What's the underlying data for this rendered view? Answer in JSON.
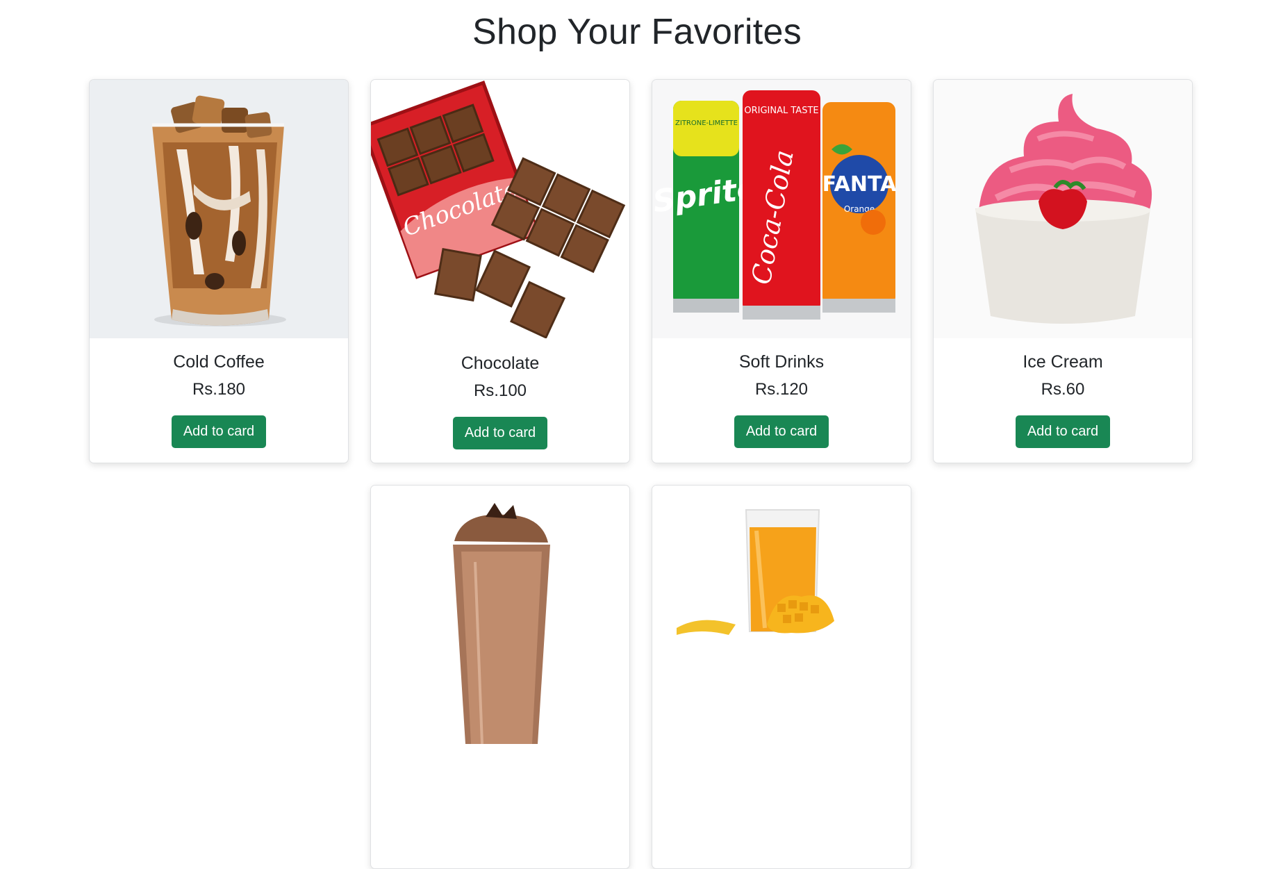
{
  "page": {
    "title": "Shop Your Favorites"
  },
  "products": [
    {
      "name": "Cold Coffee",
      "price": "Rs.180",
      "button": "Add to card",
      "image": "iced-coffee-glass-image"
    },
    {
      "name": "Chocolate",
      "price": "Rs.100",
      "button": "Add to card",
      "image": "chocolate-bar-image",
      "image_text": "Chocolate"
    },
    {
      "name": "Soft Drinks",
      "price": "Rs.120",
      "button": "Add to card",
      "image": "soda-cans-image",
      "image_text": [
        "Sprite",
        "Coca-Cola",
        "FANTA",
        "ORIGINAL TASTE",
        "ZITRONE-LIMETTE",
        "Orange"
      ]
    },
    {
      "name": "Ice Cream",
      "price": "Rs.60",
      "button": "Add to card",
      "image": "strawberry-ice-cream-cup-image"
    },
    {
      "name": "",
      "price": "",
      "button": "",
      "image": "chocolate-milkshake-image"
    },
    {
      "name": "",
      "price": "",
      "button": "",
      "image": "mango-juice-glass-image"
    }
  ],
  "colors": {
    "button_bg": "#198754",
    "button_text": "#ffffff",
    "title": "#212529"
  }
}
